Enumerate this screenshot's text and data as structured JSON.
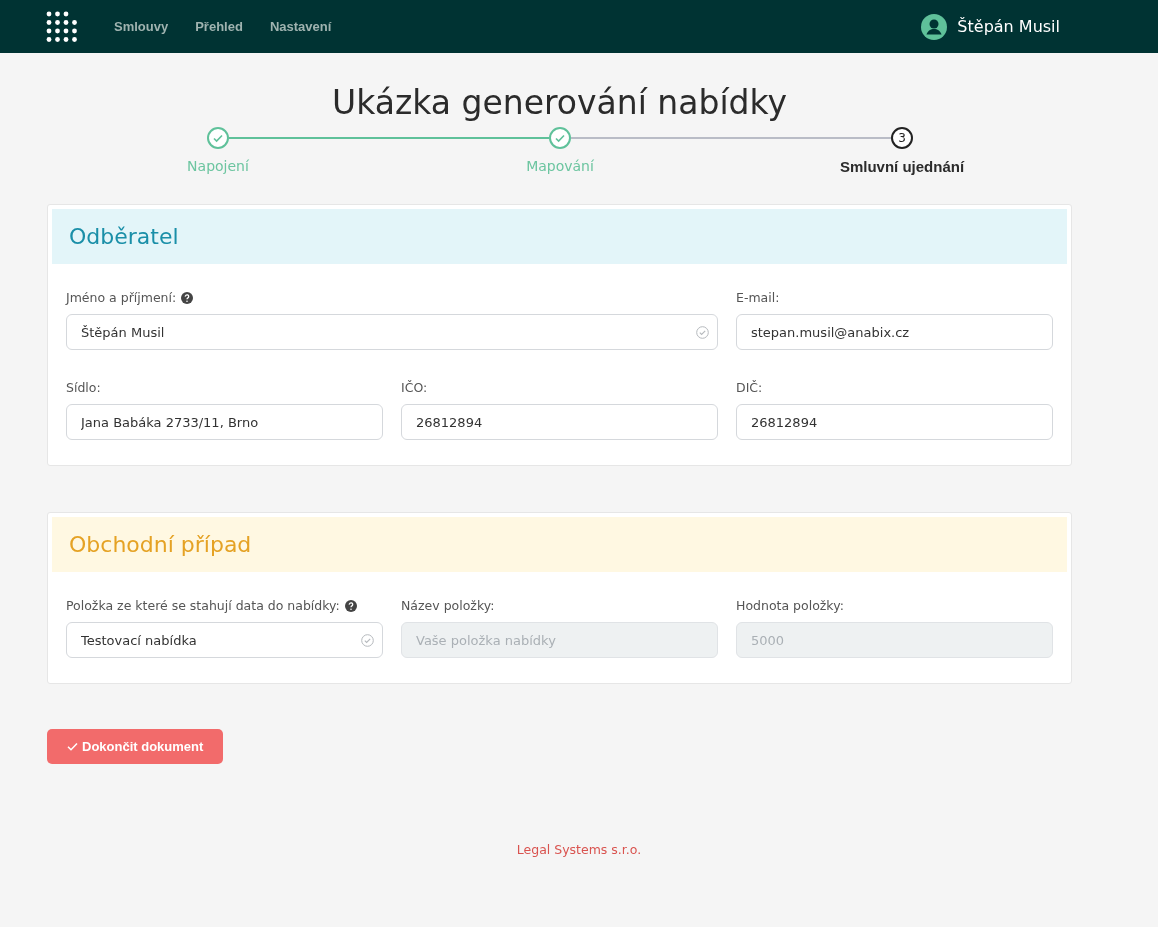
{
  "nav": {
    "items": [
      {
        "label": "Smlouvy"
      },
      {
        "label": "Přehled"
      },
      {
        "label": "Nastavení"
      }
    ],
    "user": "Štěpán Musil"
  },
  "title": "Ukázka generování nabídky",
  "steps": [
    {
      "label": "Napojení",
      "completed": true
    },
    {
      "label": "Mapování",
      "completed": true
    },
    {
      "label": "Smluvní ujednání",
      "completed": false,
      "number": "3"
    }
  ],
  "sections": [
    {
      "title": "Odběratel",
      "kind": "info",
      "fields": [
        {
          "kind": "wide",
          "label": "Jméno a příjmení:",
          "help": true,
          "value": "Štěpán Musil",
          "validated": true,
          "disabled": false
        },
        {
          "kind": "normal",
          "label": "E-mail:",
          "help": false,
          "value": "stepan.musil@anabix.cz",
          "validated": false,
          "disabled": false
        },
        {
          "kind": "normal",
          "label": "Sídlo:",
          "help": false,
          "value": "Jana Babáka 2733/11, Brno",
          "validated": false,
          "disabled": false
        },
        {
          "kind": "normal",
          "label": "IČO:",
          "help": false,
          "value": "26812894",
          "validated": false,
          "disabled": false
        },
        {
          "kind": "normal",
          "label": "DIČ:",
          "help": false,
          "value": "26812894",
          "validated": false,
          "disabled": false
        }
      ]
    },
    {
      "title": "Obchodní případ",
      "kind": "warning",
      "fields": [
        {
          "kind": "normal",
          "label": "Položka ze které se stahují data do nabídky:",
          "help": true,
          "value": "Testovací nabídka",
          "validated": true,
          "disabled": false
        },
        {
          "kind": "normal",
          "label": "Název položky:",
          "help": false,
          "placeholder": "Vaše položka nabídky",
          "validated": false,
          "disabled": true
        },
        {
          "kind": "normal",
          "label": "Hodnota položky:",
          "help": false,
          "placeholder": "5000",
          "validated": false,
          "disabled": true
        }
      ]
    }
  ],
  "finish_button": "Dokončit dokument",
  "footer": "Legal Systems s.r.o."
}
